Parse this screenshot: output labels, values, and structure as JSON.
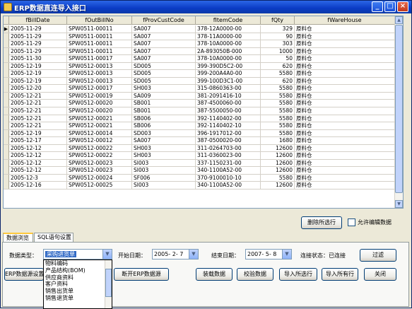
{
  "window": {
    "title": "ERP数据直连导入接口",
    "btn_min": "_",
    "btn_max": "□",
    "btn_close": "×"
  },
  "grid": {
    "columns": [
      "fBillDate",
      "fOutBillNo",
      "fProvCustCode",
      "fItemCode",
      "fQty",
      "fWareHouse"
    ],
    "rows": [
      [
        "2005-11-29",
        "SPW0511-00011",
        "SA007",
        "378-12A0000-00",
        "329",
        "原料仓"
      ],
      [
        "2005-11-29",
        "SPW0511-00011",
        "SA007",
        "378-11A0000-00",
        "90",
        "原料仓"
      ],
      [
        "2005-11-29",
        "SPW0511-00011",
        "SA007",
        "378-10A0000-00",
        "303",
        "原料仓"
      ],
      [
        "2005-11-29",
        "SPW0511-00011",
        "SA007",
        "2A-893050B-000",
        "1000",
        "原料仓"
      ],
      [
        "2005-11-30",
        "SPW0511-00017",
        "SA007",
        "378-10A0000-00",
        "50",
        "原料仓"
      ],
      [
        "2005-12-19",
        "SPW0512-00013",
        "SD005",
        "399-390D5C2-00",
        "620",
        "原料仓"
      ],
      [
        "2005-12-19",
        "SPW0512-00013",
        "SD005",
        "399-200A4A0-00",
        "5580",
        "原料仓"
      ],
      [
        "2005-12-19",
        "SPW0512-00013",
        "SD005",
        "399-100D3C1-00",
        "620",
        "原料仓"
      ],
      [
        "2005-12-20",
        "SPW0512-00017",
        "SH003",
        "315-0860363-00",
        "5580",
        "原料仓"
      ],
      [
        "2005-12-21",
        "SPW0512-00019",
        "SA009",
        "381-2091416-10",
        "5580",
        "原料仓"
      ],
      [
        "2005-12-21",
        "SPW0512-00020",
        "SB001",
        "387-4500060-00",
        "5580",
        "原料仓"
      ],
      [
        "2005-12-21",
        "SPW0512-00020",
        "SB001",
        "387-5500050-00",
        "5580",
        "原料仓"
      ],
      [
        "2005-12-21",
        "SPW0512-00021",
        "SB006",
        "392-1140402-00",
        "5580",
        "原料仓"
      ],
      [
        "2005-12-21",
        "SPW0512-00021",
        "SB006",
        "392-1140402-10",
        "5580",
        "原料仓"
      ],
      [
        "2005-12-19",
        "SPW0512-00014",
        "SD003",
        "396-1917012-00",
        "5580",
        "原料仓"
      ],
      [
        "2005-12-17",
        "SPW0512-00012",
        "SA007",
        "387-0500020-00",
        "1680",
        "原料仓"
      ],
      [
        "2005-12-12",
        "SPW0512-00022",
        "SH003",
        "311-0264703-00",
        "12600",
        "原料仓"
      ],
      [
        "2005-12-12",
        "SPW0512-00022",
        "SH003",
        "311-0360023-00",
        "12600",
        "原料仓"
      ],
      [
        "2005-12-12",
        "SPW0512-00023",
        "SI003",
        "337-1150231-00",
        "12600",
        "原料仓"
      ],
      [
        "2005-12-12",
        "SPW0512-00023",
        "SI003",
        "340-1100A52-00",
        "12600",
        "原料仓"
      ],
      [
        "2005-12-3",
        "SPW0512-00024",
        "SF006",
        "370-9100010-10",
        "5580",
        "原料仓"
      ],
      [
        "2005-12-16",
        "SPW0512-00025",
        "SI003",
        "340-1100A52-00",
        "12600",
        "原料仓"
      ]
    ],
    "current_row_marker": "▶"
  },
  "actions": {
    "delete_selected": "删除所选行",
    "allow_edit": "允许编辑数据"
  },
  "tabs": [
    "数据浏览",
    "SQL语句设置"
  ],
  "filters": {
    "data_type_label": "数据类型：",
    "data_type_value": "采购进货单",
    "start_date_label": "开始日期：",
    "start_date_value": "2005- 2- 7",
    "end_date_label": "结束日期：",
    "end_date_value": "2007- 5- 8",
    "conn_status_label": "连接状态：已连接",
    "filter_button": "过滤"
  },
  "dropdown_options": [
    "物料编码",
    "产品结构(BOM)",
    "供应商资料",
    "客户资料",
    "销售出货单",
    "销售退货单"
  ],
  "bottom_buttons": {
    "erp_source": "ERP数据源设置",
    "disconnect": "断开ERP数据源",
    "load": "装载数据",
    "verify": "校验数据",
    "import_selected": "导入所选行",
    "import_all": "导入所有行",
    "close": "关闭"
  },
  "icons": {
    "app": "app-icon",
    "dropdown": "chevron-down-icon",
    "scroll_up": "arrow-up-icon",
    "scroll_down": "arrow-down-icon"
  },
  "colors": {
    "titlebar": "#0a3bc4",
    "selection": "#316ac5",
    "window_bg": "#ece9d8"
  }
}
